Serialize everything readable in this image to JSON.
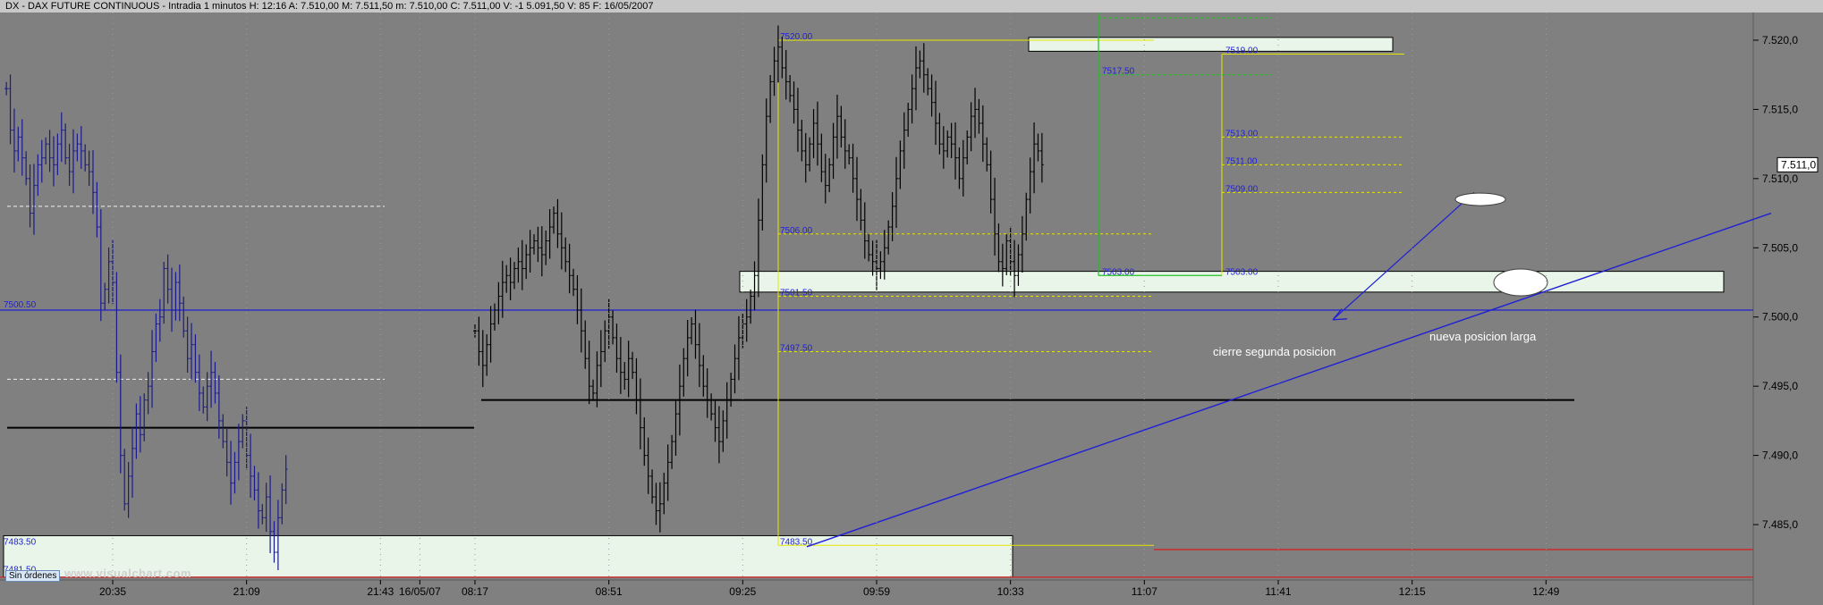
{
  "header": {
    "title": "DX - DAX FUTURE CONTINUOUS - Intradia 1 minutos  H: 12:16  A: 7.510,00  M: 7.511,50  m: 7.510,00  C: 7.511,00  V: -1 5.091,50  V: 85  F: 16/05/2007"
  },
  "footer": {
    "orders_label": "Sin órdenes",
    "watermark": "www.visualchart.com"
  },
  "colors": {
    "background": "#808080",
    "candles_previous_day": "#1a1a8c",
    "candles_current_day": "#000000",
    "support_band": "#e8f5e8",
    "yellow_levels": "#e6e600",
    "green_levels": "#22c022",
    "trendline": "#1f1fd6",
    "red_levels": "#d22222",
    "black_levels": "#000000"
  },
  "chart_data": {
    "type": "candlestick",
    "title": "DX - DAX FUTURE CONTINUOUS - Intradia 1 minutos",
    "ylim": [
      7481,
      7522
    ],
    "y_ticks": [
      "7.485,0",
      "7.490,0",
      "7.495,0",
      "7.500,0",
      "7.505,0",
      "7.510,0",
      "7.515,0",
      "7.520,0"
    ],
    "y_tick_values": [
      7485,
      7490,
      7495,
      7500,
      7505,
      7510,
      7515,
      7520
    ],
    "x_ticks": [
      "20:35",
      "21:09",
      "21:43",
      "16/05/07",
      "08:17",
      "08:51",
      "09:25",
      "09:59",
      "10:33",
      "11:07",
      "11:41",
      "12:15",
      "12:49"
    ],
    "x_tick_bar_index": [
      0,
      34,
      68,
      78,
      92,
      126,
      160,
      194,
      228,
      262,
      296,
      330,
      364
    ],
    "last_price_label": "7.511,0",
    "last_price": 7511,
    "reference_line": {
      "label": "7500.50",
      "value": 7500.5
    },
    "level_labels": [
      {
        "text": "7520.00",
        "value": 7520.0
      },
      {
        "text": "7519.00",
        "value": 7519.0
      },
      {
        "text": "7517.50",
        "value": 7517.5
      },
      {
        "text": "7513.00",
        "value": 7513.0
      },
      {
        "text": "7511.00",
        "value": 7511.0
      },
      {
        "text": "7509.00",
        "value": 7509.0
      },
      {
        "text": "7506.00",
        "value": 7506.0
      },
      {
        "text": "7503.00",
        "value": 7503.0
      },
      {
        "text": "7503.00",
        "value": 7503.0
      },
      {
        "text": "7501.50",
        "value": 7501.5
      },
      {
        "text": "7497.50",
        "value": 7497.5
      },
      {
        "text": "7483.50",
        "value": 7483.5
      },
      {
        "text": "7483.50",
        "value": 7483.5
      },
      {
        "text": "7481.50",
        "value": 7481.5
      }
    ],
    "annotations": [
      {
        "text": "cierre segunda posicion"
      },
      {
        "text": "nueva posicion  larga"
      }
    ],
    "series": [
      {
        "name": "previous session",
        "session": 1,
        "values": [
          7516.5,
          7513.5,
          7512.0,
          7513.0,
          7511.5,
          7510.0,
          7507.5,
          7509.5,
          7511.0,
          7511.5,
          7512.5,
          7511.5,
          7511.0,
          7512.5,
          7513.5,
          7511.5,
          7510.5,
          7512.0,
          7512.5,
          7512.0,
          7511.0,
          7510.5,
          7509.0,
          7506.5,
          7501.0,
          7502.0,
          7504.0,
          7502.5,
          7496.0,
          7490.0,
          7486.5,
          7488.5,
          7490.5,
          7493.0,
          7491.5,
          7494.0,
          7495.0,
          7497.5,
          7499.5,
          7500.0,
          7503.5,
          7502.0,
          7500.5,
          7502.5,
          7501.0,
          7499.0,
          7497.0,
          7498.0,
          7496.0,
          7494.5,
          7493.5,
          7495.0,
          7496.0,
          7494.5,
          7492.5,
          7491.0,
          7489.5,
          7488.0,
          7489.5,
          7491.0,
          7492.5,
          7490.0,
          7488.5,
          7487.5,
          7486.0,
          7485.5,
          7487.0,
          7484.5,
          7483.0,
          7485.5,
          7487.5,
          7489.0
        ]
      },
      {
        "name": "current session",
        "session": 2,
        "values": [
          7499.0,
          7497.5,
          7496.5,
          7498.0,
          7499.5,
          7500.5,
          7501.5,
          7502.5,
          7503.0,
          7502.5,
          7503.5,
          7504.0,
          7503.5,
          7504.5,
          7505.0,
          7505.5,
          7505.0,
          7504.5,
          7505.5,
          7506.5,
          7507.5,
          7506.0,
          7505.0,
          7504.0,
          7503.0,
          7502.0,
          7500.5,
          7499.0,
          7497.0,
          7495.0,
          7494.5,
          7496.5,
          7497.5,
          7499.0,
          7500.0,
          7498.5,
          7497.0,
          7496.0,
          7495.5,
          7497.0,
          7496.0,
          7494.0,
          7492.0,
          7490.0,
          7488.5,
          7487.0,
          7486.0,
          7486.5,
          7488.0,
          7489.5,
          7491.0,
          7493.0,
          7495.0,
          7497.0,
          7498.5,
          7499.5,
          7498.0,
          7496.5,
          7495.0,
          7494.0,
          7493.0,
          7492.0,
          7491.0,
          7492.5,
          7494.0,
          7495.5,
          7497.0,
          7498.5,
          7499.5,
          7500.0,
          7501.5,
          7503.0,
          7507.0,
          7511.0,
          7514.5,
          7517.0,
          7518.5,
          7519.5,
          7518.0,
          7517.0,
          7516.0,
          7515.0,
          7513.5,
          7512.0,
          7511.0,
          7512.5,
          7514.0,
          7512.5,
          7510.5,
          7509.5,
          7511.0,
          7513.0,
          7514.5,
          7513.0,
          7512.0,
          7511.5,
          7510.0,
          7508.5,
          7507.0,
          7505.5,
          7504.5,
          7504.0,
          7503.5,
          7504.0,
          7505.0,
          7506.5,
          7508.0,
          7510.0,
          7512.0,
          7513.5,
          7515.0,
          7516.5,
          7518.0,
          7518.5,
          7517.5,
          7516.5,
          7515.5,
          7514.0,
          7512.5,
          7512.0,
          7513.0,
          7512.5,
          7511.5,
          7510.0,
          7511.5,
          7513.0,
          7514.5,
          7515.0,
          7514.0,
          7512.5,
          7511.0,
          7508.5,
          7506.0,
          7504.0,
          7503.5,
          7505.5,
          7504.0,
          7503.0,
          7504.5,
          7506.0,
          7508.5,
          7510.5,
          7512.5,
          7512.0,
          7511.0
        ]
      }
    ]
  }
}
